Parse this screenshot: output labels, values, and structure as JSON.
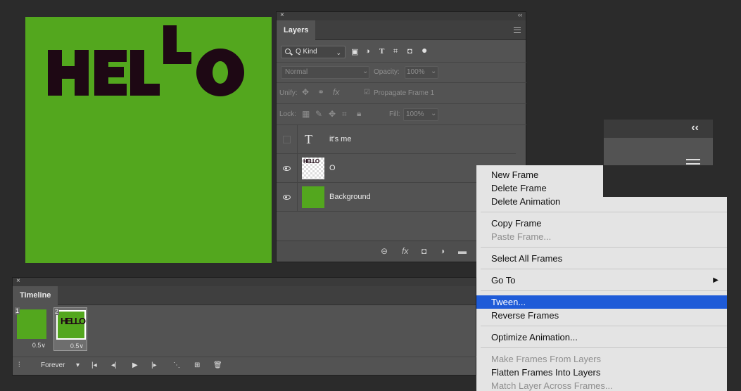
{
  "canvas": {
    "text": "HELLO",
    "bg_color": "#53a71e",
    "text_color": "#1e0814"
  },
  "layers_panel": {
    "tab": "Layers",
    "filter_kind": "Q Kind",
    "blend_mode": "Normal",
    "opacity_label": "Opacity:",
    "opacity_value": "100%",
    "unify_label": "Unify:",
    "propagate_label": "Propagate Frame 1",
    "lock_label": "Lock:",
    "fill_label": "Fill:",
    "fill_value": "100%",
    "layers": [
      {
        "name": "it's me",
        "type": "text",
        "visible": false
      },
      {
        "name": "O",
        "type": "pixel",
        "visible": true
      },
      {
        "name": "Background",
        "type": "fill",
        "visible": true
      }
    ]
  },
  "timeline": {
    "tab": "Timeline",
    "frames": [
      {
        "number": "1",
        "duration": "0.5∨"
      },
      {
        "number": "2",
        "duration": "0.5∨"
      }
    ],
    "loop": "Forever",
    "frame_text": "HELLO"
  },
  "context_menu": {
    "items": [
      {
        "label": "New Frame",
        "enabled": true
      },
      {
        "label": "Delete Frame",
        "enabled": true
      },
      {
        "label": "Delete Animation",
        "enabled": true
      },
      {
        "label": "Copy Frame",
        "enabled": true
      },
      {
        "label": "Paste Frame...",
        "enabled": false
      },
      {
        "label": "Select All Frames",
        "enabled": true
      },
      {
        "label": "Go To",
        "enabled": true,
        "submenu": true
      },
      {
        "label": "Tween...",
        "enabled": true,
        "highlighted": true
      },
      {
        "label": "Reverse Frames",
        "enabled": true
      },
      {
        "label": "Optimize Animation...",
        "enabled": true
      },
      {
        "label": "Make Frames From Layers",
        "enabled": false
      },
      {
        "label": "Flatten Frames Into Layers",
        "enabled": true
      },
      {
        "label": "Match Layer Across Frames...",
        "enabled": false
      }
    ]
  },
  "colors": {
    "highlight": "#1e5bd8",
    "panel": "#535353",
    "app_bg": "#2b2b2b"
  }
}
